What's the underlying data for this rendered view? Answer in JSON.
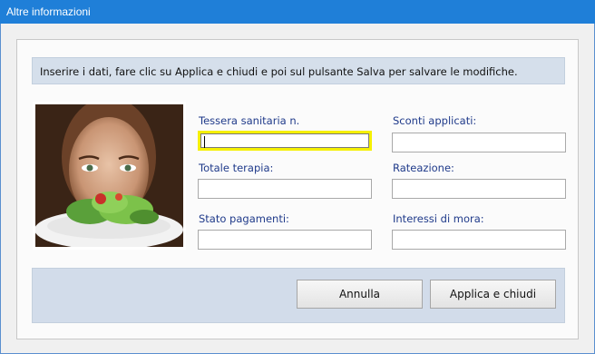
{
  "window": {
    "title": "Altre informazioni"
  },
  "info": {
    "text": "Inserire i dati, fare clic su Applica e chiudi e poi sul pulsante Salva per salvare le modifiche."
  },
  "fields": [
    {
      "label": "Tessera sanitaria n.",
      "value": ""
    },
    {
      "label": "Sconti applicati:",
      "value": ""
    },
    {
      "label": "Totale terapia:",
      "value": ""
    },
    {
      "label": "Rateazione:",
      "value": ""
    },
    {
      "label": "Stato pagamenti:",
      "value": ""
    },
    {
      "label": "Interessi di mora:",
      "value": ""
    }
  ],
  "buttons": {
    "cancel": "Annulla",
    "apply": "Applica e chiudi"
  },
  "colors": {
    "titlebar": "#1f7fd8",
    "label": "#1f3a8a",
    "focus_border": "#f5f000"
  }
}
